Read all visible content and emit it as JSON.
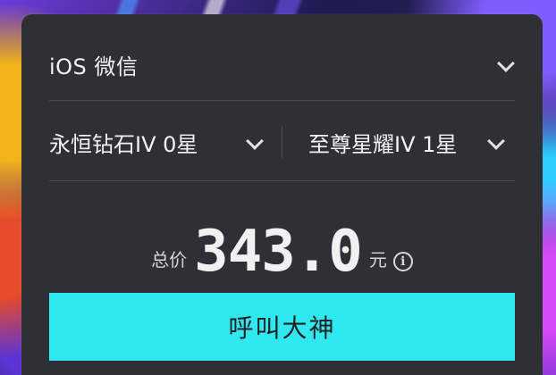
{
  "platform": {
    "label": "iOS 微信",
    "icon": "chevron-down-icon"
  },
  "rank": {
    "from": "永恒钻石IV 0星",
    "to": "至尊星耀IV 1星",
    "icon": "chevron-down-icon"
  },
  "price": {
    "label": "总价",
    "value": "343.0",
    "unit": "元",
    "info_icon": "info-icon",
    "info_glyph": "i"
  },
  "action": {
    "label": "呼叫大神"
  },
  "colors": {
    "panel": "#2f3036",
    "cta": "#2fe8f0",
    "text": "#f2f2f2"
  }
}
